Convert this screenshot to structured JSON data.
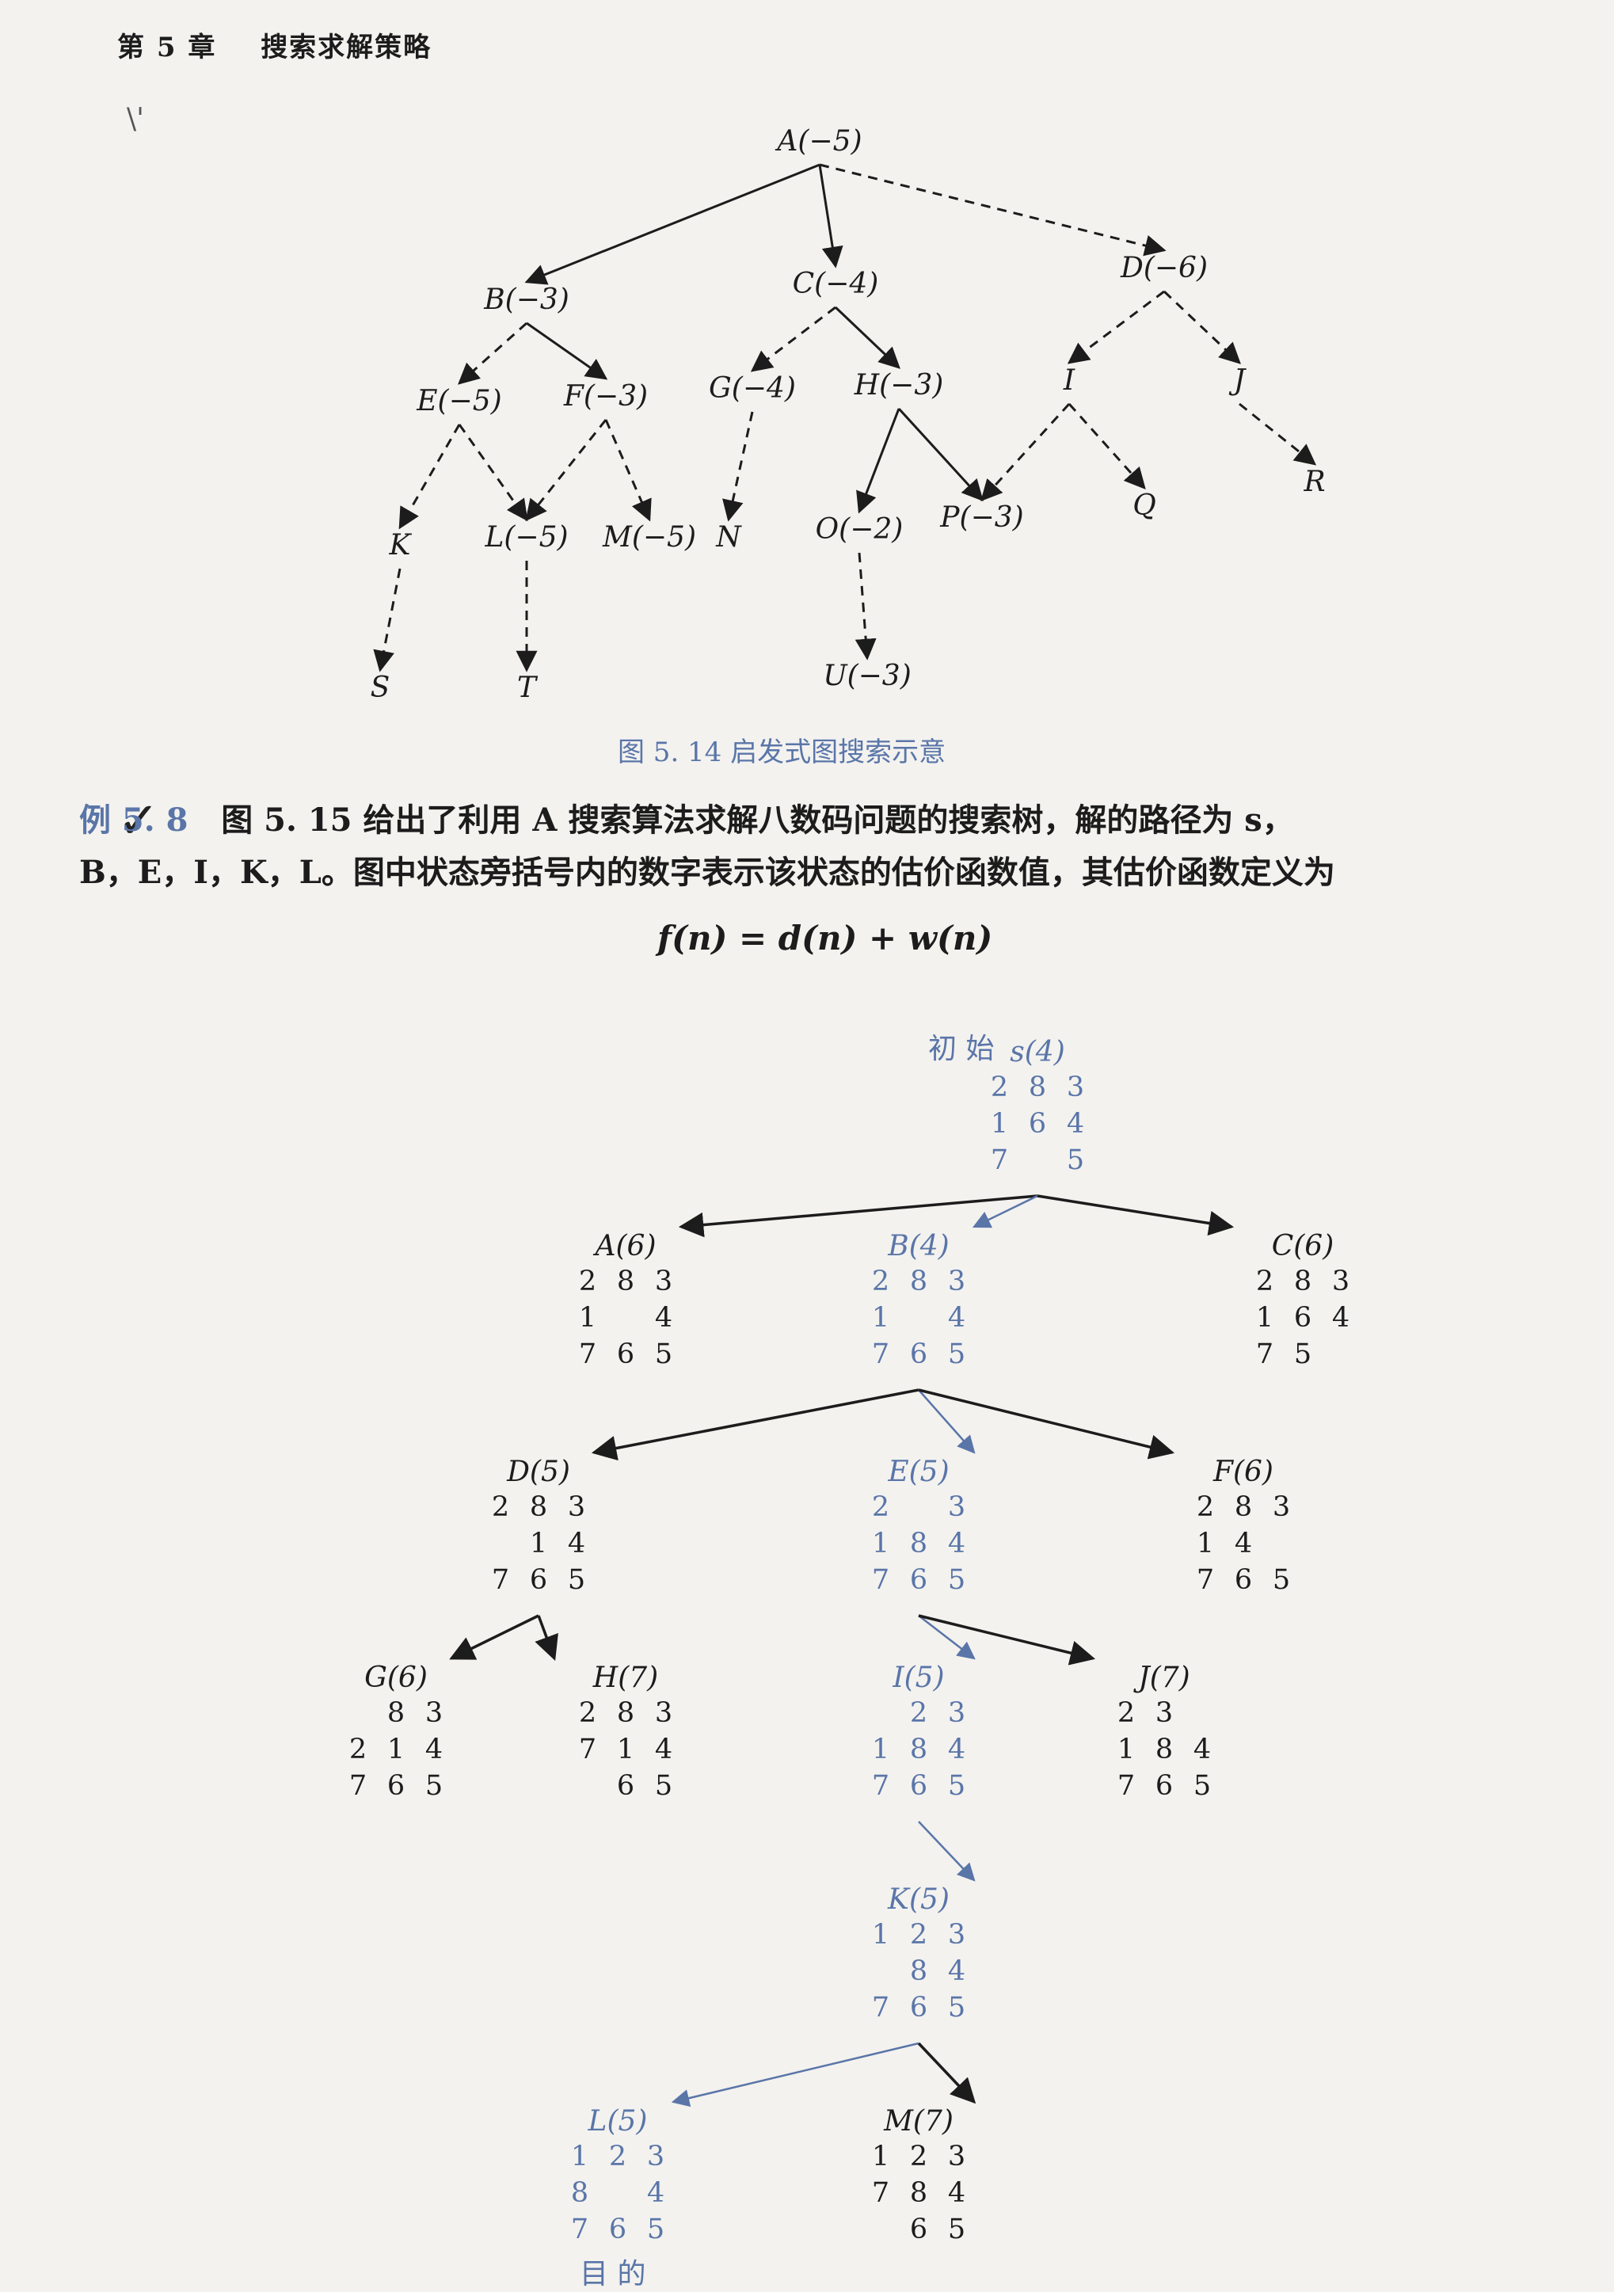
{
  "header": {
    "chapter": "第 5 章",
    "title": "搜索求解策略"
  },
  "stray_mark": "\\'",
  "figure_5_14": {
    "caption": "图 5. 14   启发式图搜索示意",
    "nodes": [
      {
        "id": "A",
        "label": "A(−5)"
      },
      {
        "id": "B",
        "label": "B(−3)"
      },
      {
        "id": "C",
        "label": "C(−4)"
      },
      {
        "id": "D",
        "label": "D(−6)"
      },
      {
        "id": "E",
        "label": "E(−5)"
      },
      {
        "id": "F",
        "label": "F(−3)"
      },
      {
        "id": "G",
        "label": "G(−4)"
      },
      {
        "id": "H",
        "label": "H(−3)"
      },
      {
        "id": "I",
        "label": "I"
      },
      {
        "id": "J",
        "label": "J"
      },
      {
        "id": "K",
        "label": "K"
      },
      {
        "id": "L",
        "label": "L(−5)"
      },
      {
        "id": "M",
        "label": "M(−5)"
      },
      {
        "id": "N",
        "label": "N"
      },
      {
        "id": "O",
        "label": "O(−2)"
      },
      {
        "id": "P",
        "label": "P(−3)"
      },
      {
        "id": "Q",
        "label": "Q"
      },
      {
        "id": "R",
        "label": "R"
      },
      {
        "id": "S",
        "label": "S"
      },
      {
        "id": "T",
        "label": "T"
      },
      {
        "id": "U",
        "label": "U(−3)"
      }
    ],
    "edges": [
      {
        "from": "A",
        "to": "B",
        "style": "solid"
      },
      {
        "from": "A",
        "to": "C",
        "style": "solid"
      },
      {
        "from": "A",
        "to": "D",
        "style": "dashed"
      },
      {
        "from": "B",
        "to": "E",
        "style": "dashed"
      },
      {
        "from": "B",
        "to": "F",
        "style": "solid"
      },
      {
        "from": "C",
        "to": "G",
        "style": "dashed"
      },
      {
        "from": "C",
        "to": "H",
        "style": "solid"
      },
      {
        "from": "D",
        "to": "I",
        "style": "dashed"
      },
      {
        "from": "D",
        "to": "J",
        "style": "dashed"
      },
      {
        "from": "E",
        "to": "K",
        "style": "dashed"
      },
      {
        "from": "E",
        "to": "L",
        "style": "dashed"
      },
      {
        "from": "F",
        "to": "L",
        "style": "dashed"
      },
      {
        "from": "F",
        "to": "M",
        "style": "dashed"
      },
      {
        "from": "G",
        "to": "N",
        "style": "dashed"
      },
      {
        "from": "H",
        "to": "O",
        "style": "solid"
      },
      {
        "from": "H",
        "to": "P",
        "style": "solid"
      },
      {
        "from": "I",
        "to": "P",
        "style": "dashed"
      },
      {
        "from": "I",
        "to": "Q",
        "style": "dashed"
      },
      {
        "from": "J",
        "to": "R",
        "style": "dashed"
      },
      {
        "from": "K",
        "to": "S",
        "style": "dashed"
      },
      {
        "from": "L",
        "to": "T",
        "style": "dashed"
      },
      {
        "from": "O",
        "to": "U",
        "style": "dashed"
      }
    ]
  },
  "example": {
    "mark": "✓",
    "tag": "例 5. 8",
    "line1": "图 5. 15 给出了利用 A 搜索算法求解八数码问题的搜索树，解的路径为 s，",
    "line2": "B，E，I，K，L。图中状态旁括号内的数字表示该状态的估价函数值，其估价函数定义为",
    "formula": "f(n) = d(n) + w(n)"
  },
  "figure_5_15": {
    "start_word": "初  始",
    "goal_word": "目  的",
    "states": [
      {
        "id": "s",
        "label": "s(4)",
        "grid": [
          "2",
          "8",
          "3",
          "1",
          "6",
          "4",
          "7",
          "",
          "5"
        ],
        "on_path": true
      },
      {
        "id": "A",
        "label": "A(6)",
        "grid": [
          "2",
          "8",
          "3",
          "1",
          "",
          "4",
          "7",
          "6",
          "5"
        ]
      },
      {
        "id": "B",
        "label": "B(4)",
        "grid": [
          "2",
          "8",
          "3",
          "1",
          "",
          "4",
          "7",
          "6",
          "5"
        ],
        "on_path": true
      },
      {
        "id": "C",
        "label": "C(6)",
        "grid": [
          "2",
          "8",
          "3",
          "1",
          "6",
          "4",
          "7",
          "5",
          ""
        ]
      },
      {
        "id": "D",
        "label": "D(5)",
        "grid": [
          "2",
          "8",
          "3",
          "",
          "1",
          "4",
          "7",
          "6",
          "5"
        ]
      },
      {
        "id": "E",
        "label": "E(5)",
        "grid": [
          "2",
          "",
          "3",
          "1",
          "8",
          "4",
          "7",
          "6",
          "5"
        ],
        "on_path": true
      },
      {
        "id": "F",
        "label": "F(6)",
        "grid": [
          "2",
          "8",
          "3",
          "1",
          "4",
          "",
          "7",
          "6",
          "5"
        ]
      },
      {
        "id": "G",
        "label": "G(6)",
        "grid": [
          "",
          "8",
          "3",
          "2",
          "1",
          "4",
          "7",
          "6",
          "5"
        ]
      },
      {
        "id": "H",
        "label": "H(7)",
        "grid": [
          "2",
          "8",
          "3",
          "7",
          "1",
          "4",
          "",
          "6",
          "5"
        ]
      },
      {
        "id": "I",
        "label": "I(5)",
        "grid": [
          "",
          "2",
          "3",
          "1",
          "8",
          "4",
          "7",
          "6",
          "5"
        ],
        "on_path": true
      },
      {
        "id": "J",
        "label": "J(7)",
        "grid": [
          "2",
          "3",
          "",
          "1",
          "8",
          "4",
          "7",
          "6",
          "5"
        ]
      },
      {
        "id": "K",
        "label": "K(5)",
        "grid": [
          "1",
          "2",
          "3",
          "",
          "8",
          "4",
          "7",
          "6",
          "5"
        ],
        "on_path": true
      },
      {
        "id": "L",
        "label": "L(5)",
        "grid": [
          "1",
          "2",
          "3",
          "8",
          "",
          "4",
          "7",
          "6",
          "5"
        ],
        "on_path": true
      },
      {
        "id": "M",
        "label": "M(7)",
        "grid": [
          "1",
          "2",
          "3",
          "7",
          "8",
          "4",
          "",
          "6",
          "5"
        ]
      }
    ],
    "edges": [
      {
        "from": "s",
        "to": "A"
      },
      {
        "from": "s",
        "to": "B"
      },
      {
        "from": "s",
        "to": "C"
      },
      {
        "from": "B",
        "to": "D"
      },
      {
        "from": "B",
        "to": "E"
      },
      {
        "from": "B",
        "to": "F"
      },
      {
        "from": "D",
        "to": "G"
      },
      {
        "from": "D",
        "to": "H"
      },
      {
        "from": "E",
        "to": "I"
      },
      {
        "from": "E",
        "to": "J"
      },
      {
        "from": "I",
        "to": "K"
      },
      {
        "from": "K",
        "to": "L"
      },
      {
        "from": "K",
        "to": "M"
      }
    ]
  },
  "colors": {
    "path_blue": "#5a75a8",
    "ink": "#1c1c1c",
    "paper": "#f3f2ef"
  }
}
